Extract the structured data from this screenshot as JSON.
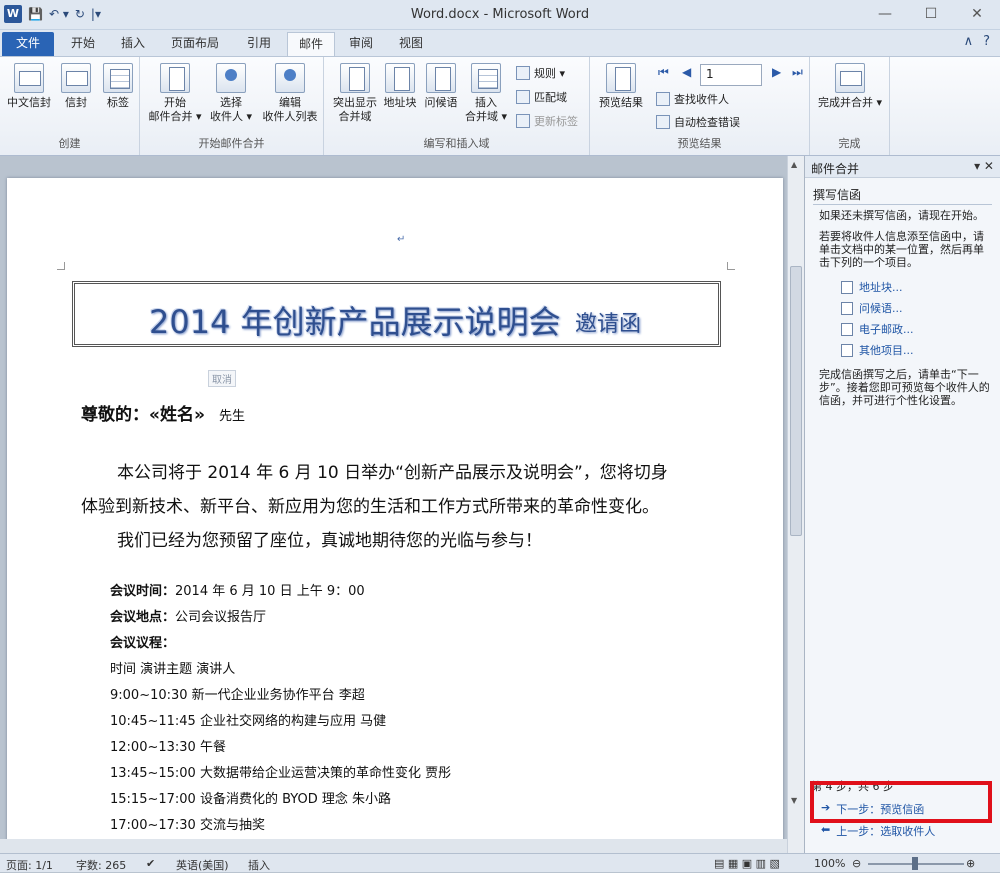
{
  "window": {
    "title": "Word.docx - Microsoft Word",
    "min": "—",
    "max": "☐",
    "close": "✕"
  },
  "qat": {
    "logo": "W",
    "save": "💾",
    "undo": "↶ ▾",
    "redo": "↻",
    "more": "|▾"
  },
  "tabs": [
    {
      "label": "文件"
    },
    {
      "label": "开始"
    },
    {
      "label": "插入"
    },
    {
      "label": "页面布局"
    },
    {
      "label": "引用"
    },
    {
      "label": "邮件"
    },
    {
      "label": "审阅"
    },
    {
      "label": "视图"
    }
  ],
  "tabs_right": {
    "collapse": "∧",
    "help": "?"
  },
  "ribbon": {
    "create": {
      "label": "创建",
      "btn1": "中文信封",
      "btn2": "信封",
      "btn3": "标签"
    },
    "start": {
      "label": "开始邮件合并",
      "btn1a": "开始",
      "btn1b": "邮件合并 ▾",
      "btn2a": "选择",
      "btn2b": "收件人 ▾",
      "btn3a": "编辑",
      "btn3b": "收件人列表"
    },
    "write": {
      "label": "编写和插入域",
      "btn1a": "突出显示",
      "btn1b": "合并域",
      "btn2": "地址块",
      "btn3": "问候语",
      "btn4a": "插入",
      "btn4b": "合并域 ▾",
      "rules": "规则 ▾",
      "match": "匹配域",
      "update": "更新标签"
    },
    "preview": {
      "label": "预览结果",
      "btn": "预览结果",
      "record": "1",
      "find": "查找收件人",
      "check": "自动检查错误",
      "first": "⏮",
      "prev": "◀",
      "next": "▶",
      "last": "⏭"
    },
    "finish": {
      "label": "完成",
      "btn": "完成并合并 ▾"
    }
  },
  "document": {
    "title_main": "2014 年创新产品展示说明会",
    "title_sub": "邀请函",
    "cancel_tip": "取消",
    "greeting": "尊敬的：«姓名»",
    "greeting_suffix": "先生",
    "para1_line1": "本公司将于 2014 年 6 月 10 日举办“创新产品展示及说明会”，您将切身",
    "para1_line2": "体验到新技术、新平台、新应用为您的生活和工作方式所带来的革命性变化。",
    "para2": "我们已经为您预留了座位，真诚地期待您的光临与参与！",
    "agenda": [
      {
        "label": "会议时间：",
        "text": "2014 年 6 月 10 日 上午 9：00"
      },
      {
        "label": "会议地点：",
        "text": "公司会议报告厅"
      },
      {
        "label": "会议议程：",
        "text": ""
      },
      {
        "label": "",
        "text": "时间       演讲主题       演讲人"
      },
      {
        "label": "",
        "text": "9:00~10:30   新一代企业业务协作平台   李超"
      },
      {
        "label": "",
        "text": "10:45~11:45 企业社交网络的构建与应用       马健"
      },
      {
        "label": "",
        "text": "12:00~13:30 午餐"
      },
      {
        "label": "",
        "text": "13:45~15:00 大数据带给企业运营决策的革命性变化    贾彤"
      },
      {
        "label": "",
        "text": "15:15~17:00 设备消费化的 BYOD 理念  朱小路"
      },
      {
        "label": "",
        "text": "17:00~17:30 交流与抽奖"
      }
    ]
  },
  "pane": {
    "title": "邮件合并",
    "section": "撰写信函",
    "text1": "如果还未撰写信函，请现在开始。",
    "text2": "若要将收件人信息添至信函中，请单击文档中的某一位置，然后再单击下列的一个项目。",
    "links": [
      {
        "label": "地址块..."
      },
      {
        "label": "问候语..."
      },
      {
        "label": "电子邮政..."
      },
      {
        "label": "其他项目..."
      }
    ],
    "text3": "完成信函撰写之后，请单击“下一步”。接着您即可预览每个收件人的信函，并可进行个性化设置。",
    "steps_label": "第 4 步，共 6 步",
    "next_step": "下一步：预览信函",
    "prev_step": "上一步：选取收件人"
  },
  "status": {
    "page": "页面: 1/1",
    "words": "字数: 265",
    "lang": "英语(美国)",
    "mode": "插入",
    "zoom": "100%"
  }
}
